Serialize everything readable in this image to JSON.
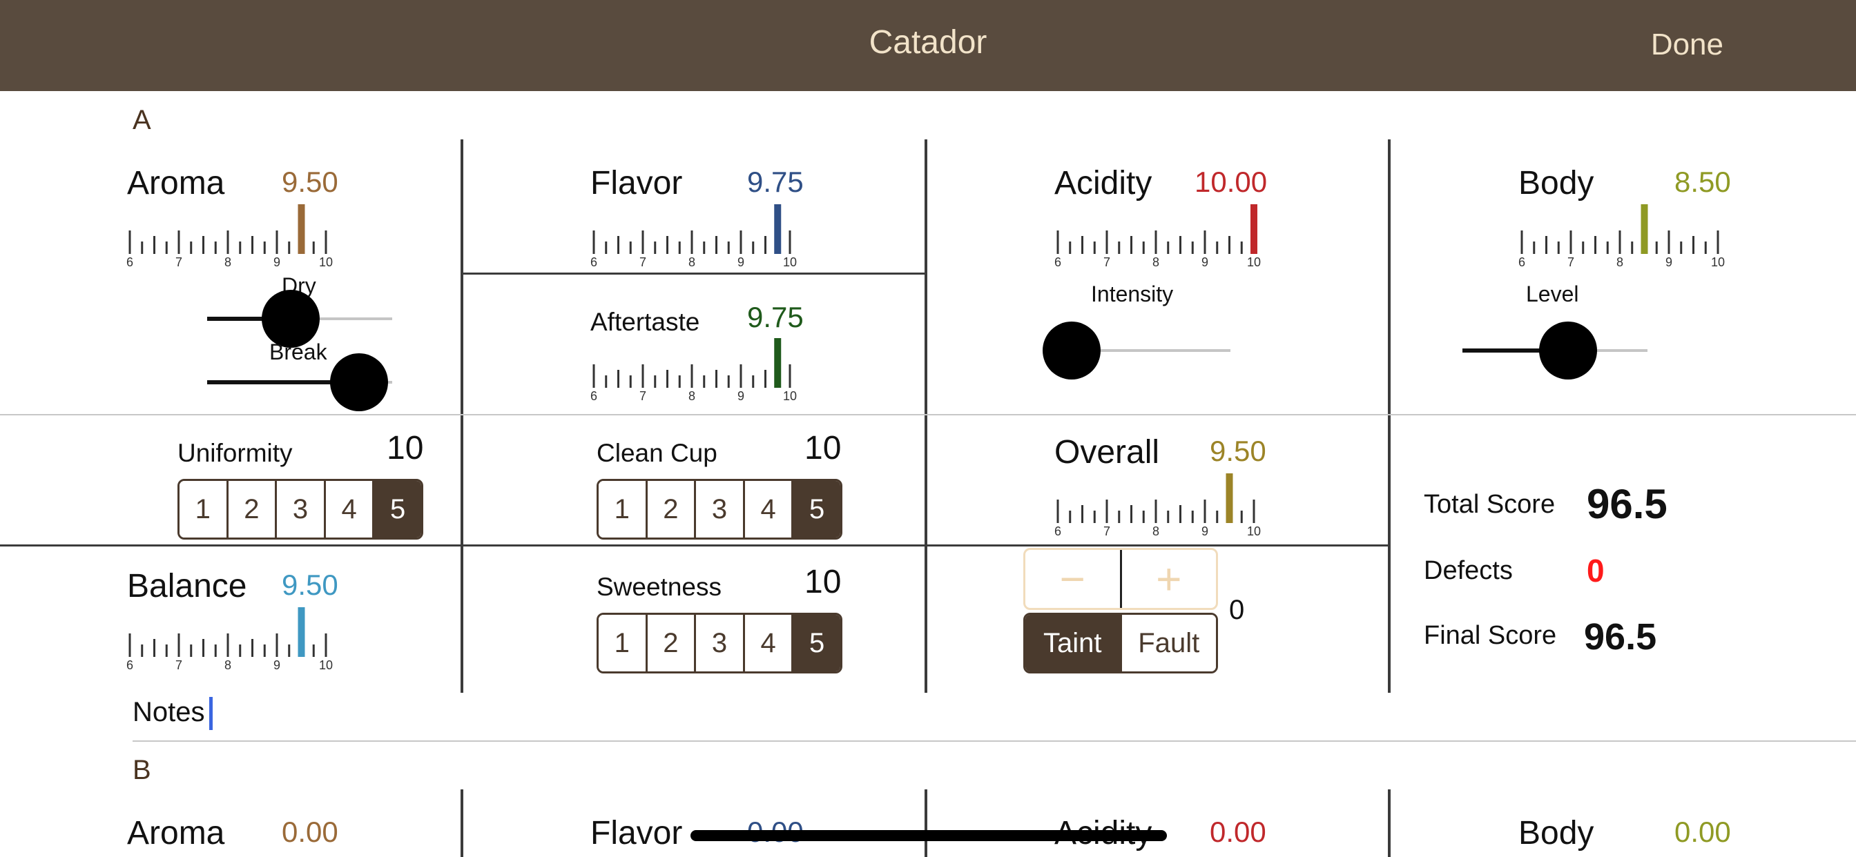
{
  "app": {
    "title": "Catador",
    "done_label": "Done"
  },
  "colors": {
    "nav_bg": "#594b3e",
    "nav_text": "#f2e3c9",
    "aroma": "#9a6a38",
    "flavor": "#2f4f86",
    "acidity": "#c0282b",
    "body": "#8f9a24",
    "aftertaste": "#1f5a1b",
    "overall": "#9c8427",
    "balance": "#3f98c2",
    "defects": "#ff1a1a",
    "segment_dark": "#4a3a2d"
  },
  "ruler_ticks": [
    "6",
    "7",
    "8",
    "9",
    "10"
  ],
  "sample_a": {
    "label": "A",
    "aroma": {
      "name": "Aroma",
      "score": "9.50",
      "value": 9.5
    },
    "dry": {
      "label": "Dry",
      "fraction": 0.45
    },
    "break": {
      "label": "Break",
      "fraction": 0.82
    },
    "flavor": {
      "name": "Flavor",
      "score": "9.75",
      "value": 9.75
    },
    "aftertaste": {
      "name": "Aftertaste",
      "score": "9.75",
      "value": 9.75
    },
    "acidity": {
      "name": "Acidity",
      "score": "10.00",
      "value": 10.0
    },
    "intensity": {
      "label": "Intensity",
      "fraction": 0.0
    },
    "body": {
      "name": "Body",
      "score": "8.50",
      "value": 8.5
    },
    "level": {
      "label": "Level",
      "fraction": 0.57
    },
    "uniformity": {
      "name": "Uniformity",
      "count": "10",
      "options": [
        "1",
        "2",
        "3",
        "4",
        "5"
      ],
      "selected": "5"
    },
    "clean_cup": {
      "name": "Clean Cup",
      "count": "10",
      "options": [
        "1",
        "2",
        "3",
        "4",
        "5"
      ],
      "selected": "5"
    },
    "overall": {
      "name": "Overall",
      "score": "9.50",
      "value": 9.5
    },
    "balance": {
      "name": "Balance",
      "score": "9.50",
      "value": 9.5
    },
    "sweetness": {
      "name": "Sweetness",
      "count": "10",
      "options": [
        "1",
        "2",
        "3",
        "4",
        "5"
      ],
      "selected": "5"
    },
    "defect_stepper": {
      "minus": "−",
      "plus": "+",
      "count": "0"
    },
    "defect_type": {
      "options": [
        "Taint",
        "Fault"
      ],
      "selected": "Taint"
    },
    "summary": {
      "total_label": "Total Score",
      "total_value": "96.5",
      "defects_label": "Defects",
      "defects_value": "0",
      "final_label": "Final Score",
      "final_value": "96.5"
    },
    "notes_label": "Notes"
  },
  "sample_b": {
    "label": "B",
    "aroma": {
      "name": "Aroma",
      "score": "0.00"
    },
    "flavor": {
      "name": "Flavor",
      "score": "0.00"
    },
    "acidity": {
      "name": "Acidity",
      "score": "0.00"
    },
    "body": {
      "name": "Body",
      "score": "0.00"
    }
  }
}
